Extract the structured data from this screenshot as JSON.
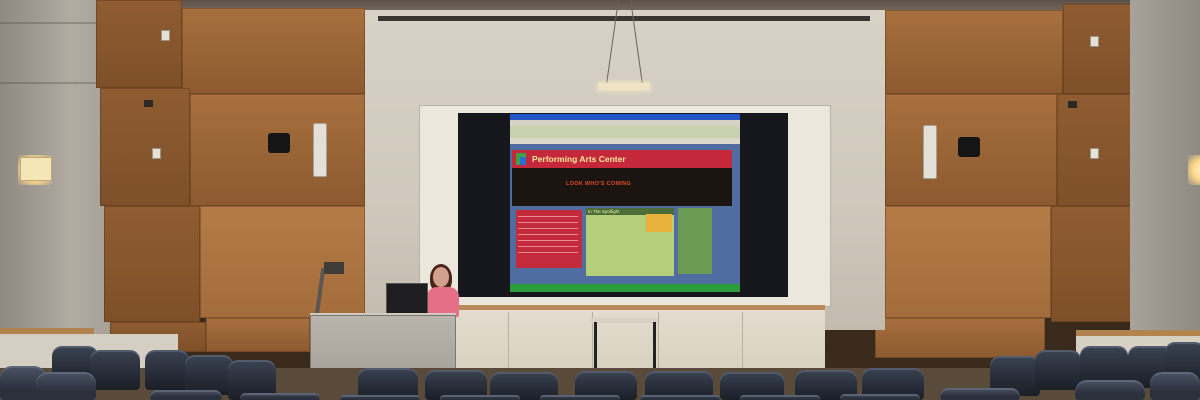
{
  "scene": {
    "screen_title": "Performing Arts Center",
    "banner_text": "LOOK WHO'S COMING",
    "main_heading": "In The Spotlight"
  },
  "colors": {
    "wood": "#9b6637",
    "wall": "#d8d2c6",
    "screen_red": "#c6283b",
    "screen_blue": "#4f6da0",
    "seat": "#2a303c",
    "presenter_top": "#e56f86"
  }
}
